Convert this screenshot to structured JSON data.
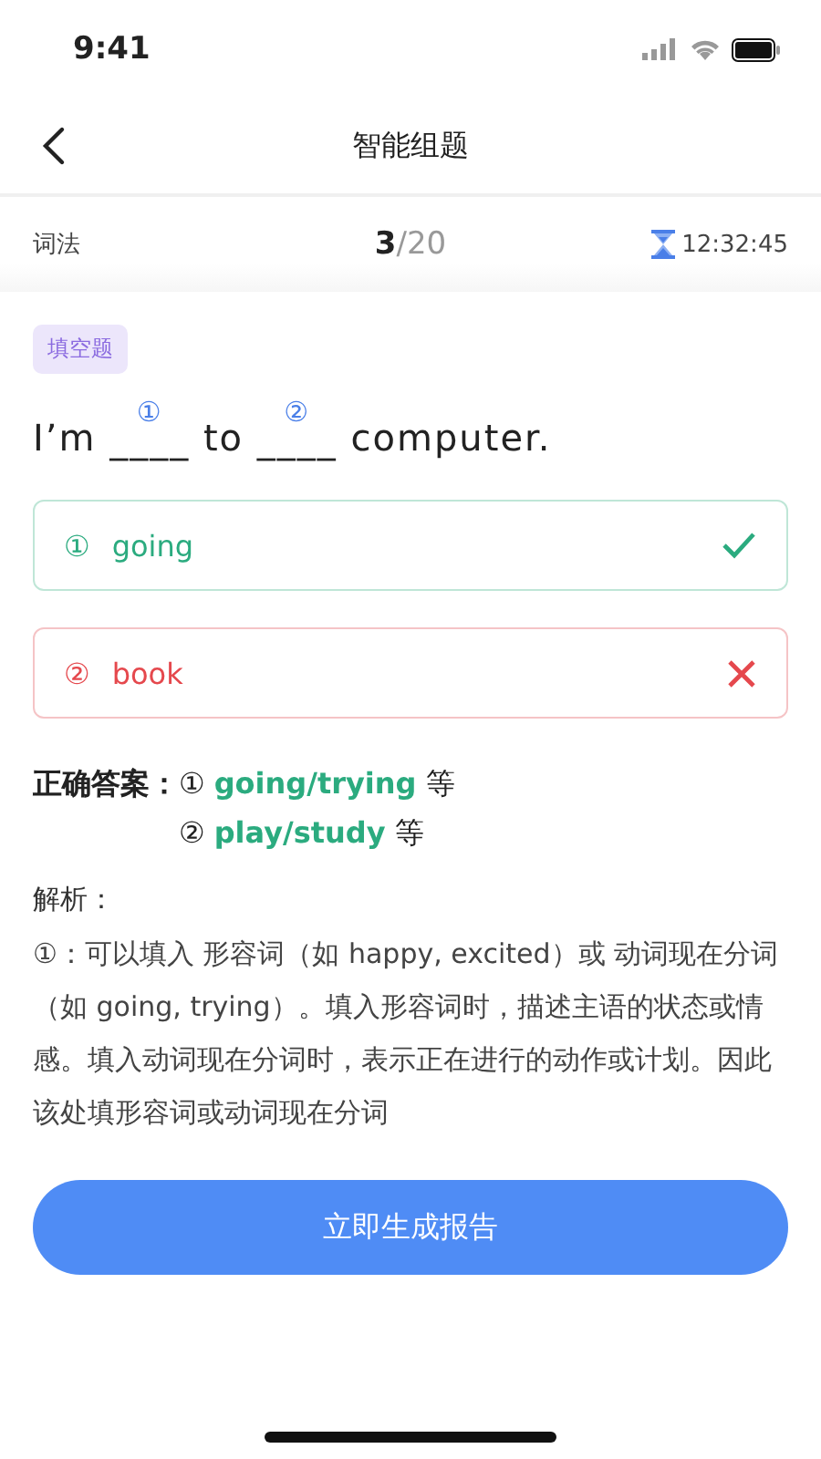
{
  "status_bar": {
    "time": "9:41"
  },
  "nav": {
    "title": "智能组题"
  },
  "info_bar": {
    "category": "词法",
    "progress": {
      "current": "3",
      "separator": "/",
      "total": "20"
    },
    "timer": "12:32:45"
  },
  "question": {
    "tag": "填空题",
    "sentence": [
      {
        "kind": "text",
        "text": "I’m "
      },
      {
        "kind": "blank",
        "line": "____",
        "mark": "①"
      },
      {
        "kind": "text",
        "text": " to "
      },
      {
        "kind": "blank",
        "line": "____",
        "mark": "②"
      },
      {
        "kind": "text",
        "text": " computer."
      }
    ]
  },
  "answers": [
    {
      "mark": "①",
      "text": "going",
      "correct": true
    },
    {
      "mark": "②",
      "text": "book",
      "correct": false
    }
  ],
  "correct_answer": {
    "label": "正确答案：",
    "items": [
      {
        "mark": "①",
        "answer": "going/trying",
        "suffix": "等"
      },
      {
        "mark": "②",
        "answer": "play/study",
        "suffix": "等"
      }
    ]
  },
  "analysis": {
    "title": "解析：",
    "text": "①：可以填入 形容词（如 happy, excited）或 动词现在分词（如 going, trying）。填入形容词时，描述主语的状态或情感。填入动词现在分词时，表示正在进行的动作或计划。因此该处填形容词或动词现在分词"
  },
  "button": {
    "label": "立即生成报告"
  }
}
